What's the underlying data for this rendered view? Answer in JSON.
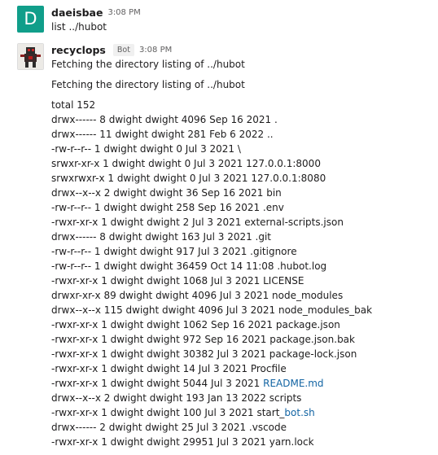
{
  "messages": [
    {
      "author": "daeisbae",
      "avatar_letter": "D",
      "time": "3:08 PM",
      "text": "list ../hubot"
    },
    {
      "author": "recyclops",
      "badge": "Bot",
      "time": "3:08 PM",
      "line1": "Fetching the directory listing of ../hubot",
      "line2": "Fetching the directory listing of ../hubot",
      "listing": [
        {
          "prefix": "total 152"
        },
        {
          "prefix": "drwx------ 8 dwight dwight 4096 Sep 16 2021 ."
        },
        {
          "prefix": "drwx------ 11 dwight dwight 281 Feb 6 2022 .."
        },
        {
          "prefix": "-rw-r--r-- 1 dwight dwight 0 Jul 3 2021 \\"
        },
        {
          "prefix": "srwxr-xr-x 1 dwight dwight 0 Jul 3 2021 127.0.0.1:8000"
        },
        {
          "prefix": "srwxrwxr-x 1 dwight dwight 0 Jul 3 2021 127.0.0.1:8080"
        },
        {
          "prefix": "drwx--x--x 2 dwight dwight 36 Sep 16 2021 bin"
        },
        {
          "prefix": "-rw-r--r-- 1 dwight dwight 258 Sep 16 2021 .env"
        },
        {
          "prefix": "-rwxr-xr-x 1 dwight dwight 2 Jul 3 2021 external-scripts.json"
        },
        {
          "prefix": "drwx------ 8 dwight dwight 163 Jul 3 2021 .git"
        },
        {
          "prefix": "-rw-r--r-- 1 dwight dwight 917 Jul 3 2021 .gitignore"
        },
        {
          "prefix": "-rw-r--r-- 1 dwight dwight 36459 Oct 14 11:08 .hubot.log"
        },
        {
          "prefix": "-rwxr-xr-x 1 dwight dwight 1068 Jul 3 2021 LICENSE"
        },
        {
          "prefix": "drwxr-xr-x 89 dwight dwight 4096 Jul 3 2021 node_modules"
        },
        {
          "prefix": "drwx--x--x 115 dwight dwight 4096 Jul 3 2021 node_modules_bak"
        },
        {
          "prefix": "-rwxr-xr-x 1 dwight dwight 1062 Sep 16 2021 package.json"
        },
        {
          "prefix": "-rwxr-xr-x 1 dwight dwight 972 Sep 16 2021 package.json.bak"
        },
        {
          "prefix": "-rwxr-xr-x 1 dwight dwight 30382 Jul 3 2021 package-lock.json"
        },
        {
          "prefix": "-rwxr-xr-x 1 dwight dwight 14 Jul 3 2021 Procfile"
        },
        {
          "prefix": "-rwxr-xr-x 1 dwight dwight 5044 Jul 3 2021 ",
          "link": "README.md"
        },
        {
          "prefix": "drwx--x--x 2 dwight dwight 193 Jan 13 2022 scripts"
        },
        {
          "prefix": "-rwxr-xr-x 1 dwight dwight 100 Jul 3 2021 start_",
          "link": "bot.sh"
        },
        {
          "prefix": "drwx------ 2 dwight dwight 25 Jul 3 2021 .vscode"
        },
        {
          "prefix": "-rwxr-xr-x 1 dwight dwight 29951 Jul 3 2021 yarn.lock"
        }
      ]
    }
  ],
  "colors": {
    "avatar_bg": "#109e8a",
    "link": "#1264a3"
  }
}
